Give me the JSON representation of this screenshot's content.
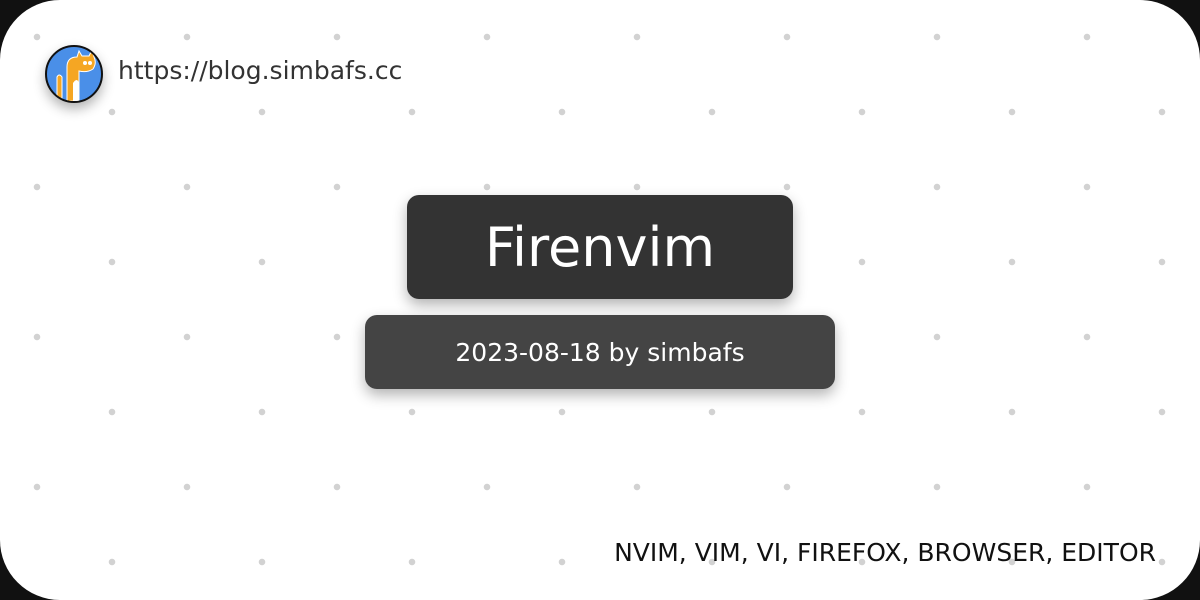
{
  "site": {
    "url": "https://blog.simbafs.cc"
  },
  "post": {
    "title": "Firenvim",
    "meta": "2023-08-18 by simbafs",
    "tags": "NVIM, VIM, VI, FIREFOX, BROWSER, EDITOR"
  },
  "colors": {
    "title_bg": "#333333",
    "meta_bg": "#444444",
    "avatar_bg": "#4a8fe8",
    "cat": "#f5a623"
  }
}
